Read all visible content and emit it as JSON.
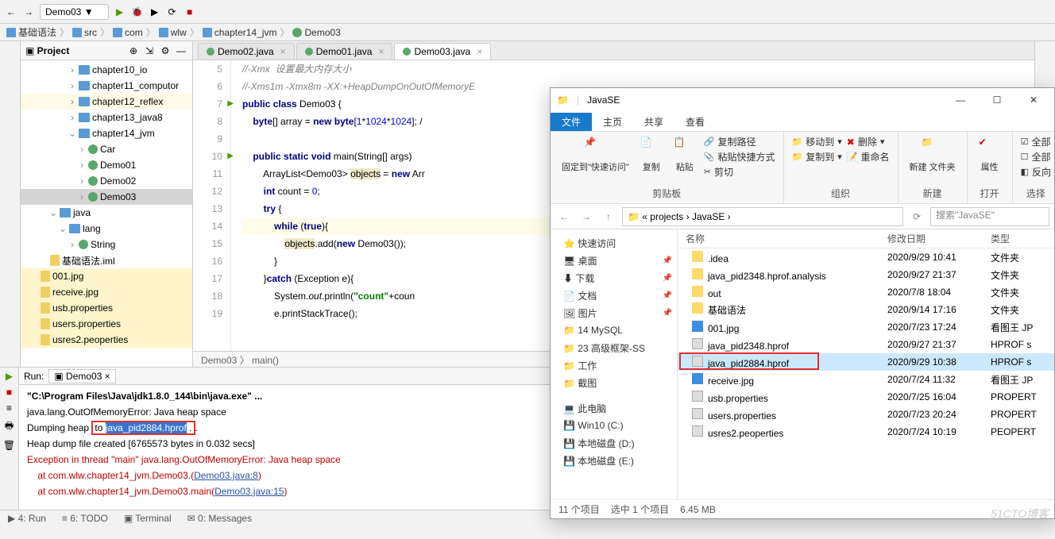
{
  "toolbar": {
    "run_config": "Demo03"
  },
  "breadcrumbs": [
    "基础语法",
    "src",
    "com",
    "wlw",
    "chapter14_jvm",
    "Demo03"
  ],
  "project_panel": {
    "title": "Project",
    "tree": [
      {
        "d": 5,
        "t": "a",
        "k": "fold",
        "l": "chapter10_io"
      },
      {
        "d": 5,
        "t": "a",
        "k": "fold",
        "l": "chapter11_computor"
      },
      {
        "d": 5,
        "t": "a",
        "k": "fold",
        "l": "chapter12_reflex",
        "y": 1
      },
      {
        "d": 5,
        "t": "a",
        "k": "fold",
        "l": "chapter13_java8"
      },
      {
        "d": 5,
        "t": "v",
        "k": "fold",
        "l": "chapter14_jvm"
      },
      {
        "d": 6,
        "t": "a",
        "k": "cls",
        "l": "Car"
      },
      {
        "d": 6,
        "t": "a",
        "k": "cls",
        "l": "Demo01"
      },
      {
        "d": 6,
        "t": "a",
        "k": "cls",
        "l": "Demo02"
      },
      {
        "d": 6,
        "t": "a",
        "k": "cls",
        "l": "Demo03",
        "sel": 1
      },
      {
        "d": 3,
        "t": "v",
        "k": "fold",
        "l": "java"
      },
      {
        "d": 4,
        "t": "v",
        "k": "fold",
        "l": "lang"
      },
      {
        "d": 5,
        "t": "a",
        "k": "cls",
        "l": "String"
      },
      {
        "d": 2,
        "t": "",
        "k": "file",
        "l": "基础语法.iml"
      },
      {
        "d": 1,
        "t": "",
        "k": "file",
        "l": "001.jpg",
        "y": 2
      },
      {
        "d": 1,
        "t": "",
        "k": "file",
        "l": "receive.jpg",
        "y": 2
      },
      {
        "d": 1,
        "t": "",
        "k": "file",
        "l": "usb.properties",
        "y": 2
      },
      {
        "d": 1,
        "t": "",
        "k": "file",
        "l": "users.properties",
        "y": 2
      },
      {
        "d": 1,
        "t": "",
        "k": "file",
        "l": "usres2.peoperties",
        "y": 2
      }
    ]
  },
  "tabs": [
    "Demo02.java",
    "Demo01.java",
    "Demo03.java"
  ],
  "active_tab": 2,
  "code": {
    "start": 5,
    "lines": [
      "//-Xmx  设置最大内存大小",
      "//-Xms1m -Xmx8m -XX:+HeapDumpOnOutOfMemoryE",
      "public class Demo03 {",
      "    byte[] array = new byte[1*1024*1024]; /",
      "",
      "    public static void main(String[] args) ",
      "        ArrayList<Demo03> objects = new Arr",
      "        int count = 0;",
      "        try {",
      "            while (true){",
      "                objects.add(new Demo03());",
      "            }",
      "        }catch (Exception e){",
      "            System.out.println(\"count\"+coun",
      "            e.printStackTrace();"
    ],
    "run_marks": [
      7,
      10
    ],
    "highlight_line": 14,
    "crumb": "Demo03 〉 main()"
  },
  "run": {
    "label": "Run:",
    "config": "Demo03",
    "lines": [
      {
        "t": "\"C:\\Program Files\\Java\\jdk1.8.0_144\\bin\\java.exe\" ...",
        "cls": "cmd"
      },
      {
        "t": "java.lang.OutOfMemoryError: Java heap space"
      },
      {
        "pre": "Dumping heap ",
        "box_pre": "to ",
        "sel": "java_pid2884.hprof",
        "box_post": " .",
        "post": "."
      },
      {
        "t": "Heap dump file created [6765573 bytes in 0.032 secs]"
      },
      {
        "t": "Exception in thread \"main\" java.lang.OutOfMemoryError: Java heap space",
        "cls": "err"
      },
      {
        "pre_err": "    at com.wlw.chapter14_jvm.Demo03.<init>(",
        "lnk": "Demo03.java:8",
        "post_err": ")"
      },
      {
        "pre_err": "    at com.wlw.chapter14_jvm.Demo03.main(",
        "lnk": "Demo03.java:15",
        "post_err": ")"
      }
    ]
  },
  "statusbar": [
    "▶ 4: Run",
    "≡ 6: TODO",
    "▣ Terminal",
    "✉ 0: Messages"
  ],
  "explorer": {
    "title": "JavaSE",
    "rib_tabs": [
      "文件",
      "主页",
      "共享",
      "查看"
    ],
    "ribbon": {
      "pin": "固定到\"快速访问\"",
      "copy": "复制",
      "paste": "粘贴",
      "copypath": "复制路径",
      "pasteshort": "粘贴快捷方式",
      "cut": "剪切",
      "g1": "剪贴板",
      "moveto": "移动到",
      "copyto": "复制到",
      "delete": "删除",
      "rename": "重命名",
      "g2": "组织",
      "newfolder": "新建\n文件夹",
      "g3": "新建",
      "props": "属性",
      "g4": "打开",
      "selall": "全部",
      "selnone": "全部",
      "selinv": "反向",
      "g5": "选择"
    },
    "path_crumbs": [
      "« projects",
      "JavaSE"
    ],
    "search_placeholder": "搜索\"JavaSE\"",
    "nav": [
      {
        "l": "快速访问",
        "i": "star"
      },
      {
        "l": "桌面",
        "i": "desk",
        "pin": 1
      },
      {
        "l": "下载",
        "i": "dl",
        "pin": 1
      },
      {
        "l": "文档",
        "i": "doc",
        "pin": 1
      },
      {
        "l": "图片",
        "i": "pic",
        "pin": 1
      },
      {
        "l": "14 MySQL",
        "i": "fold"
      },
      {
        "l": "23 高级框架-SS",
        "i": "fold"
      },
      {
        "l": "工作",
        "i": "fold"
      },
      {
        "l": "截图",
        "i": "fold"
      },
      {
        "l": "",
        "spacer": 1
      },
      {
        "l": "此电脑",
        "i": "pc"
      },
      {
        "l": "Win10 (C:)",
        "i": "disk"
      },
      {
        "l": "本地磁盘 (D:)",
        "i": "disk"
      },
      {
        "l": "本地磁盘 (E:)",
        "i": "disk"
      }
    ],
    "cols": {
      "name": "名称",
      "date": "修改日期",
      "type": "类型"
    },
    "rows": [
      {
        "n": ".idea",
        "d": "2020/9/29 10:41",
        "t": "文件夹",
        "i": "fold"
      },
      {
        "n": "java_pid2348.hprof.analysis",
        "d": "2020/9/27 21:37",
        "t": "文件夹",
        "i": "fold"
      },
      {
        "n": "out",
        "d": "2020/7/8 18:04",
        "t": "文件夹",
        "i": "fold"
      },
      {
        "n": "基础语法",
        "d": "2020/9/14 17:16",
        "t": "文件夹",
        "i": "fold"
      },
      {
        "n": "001.jpg",
        "d": "2020/7/23 17:24",
        "t": "看图王 JP",
        "i": "jpg"
      },
      {
        "n": "java_pid2348.hprof",
        "d": "2020/9/27 21:37",
        "t": "HPROF s",
        "i": "file"
      },
      {
        "n": "java_pid2884.hprof",
        "d": "2020/9/29 10:38",
        "t": "HPROF s",
        "i": "file",
        "sel": 1
      },
      {
        "n": "receive.jpg",
        "d": "2020/7/24 11:32",
        "t": "看图王 JP",
        "i": "jpg"
      },
      {
        "n": "usb.properties",
        "d": "2020/7/25 16:04",
        "t": "PROPERT",
        "i": "file"
      },
      {
        "n": "users.properties",
        "d": "2020/7/23 20:24",
        "t": "PROPERT",
        "i": "file"
      },
      {
        "n": "usres2.peoperties",
        "d": "2020/7/24 10:19",
        "t": "PEOPERT",
        "i": "file"
      }
    ],
    "status": {
      "count": "11 个项目",
      "sel": "选中 1 个项目",
      "size": "6.45 MB"
    }
  },
  "watermark": "51CTO博客"
}
